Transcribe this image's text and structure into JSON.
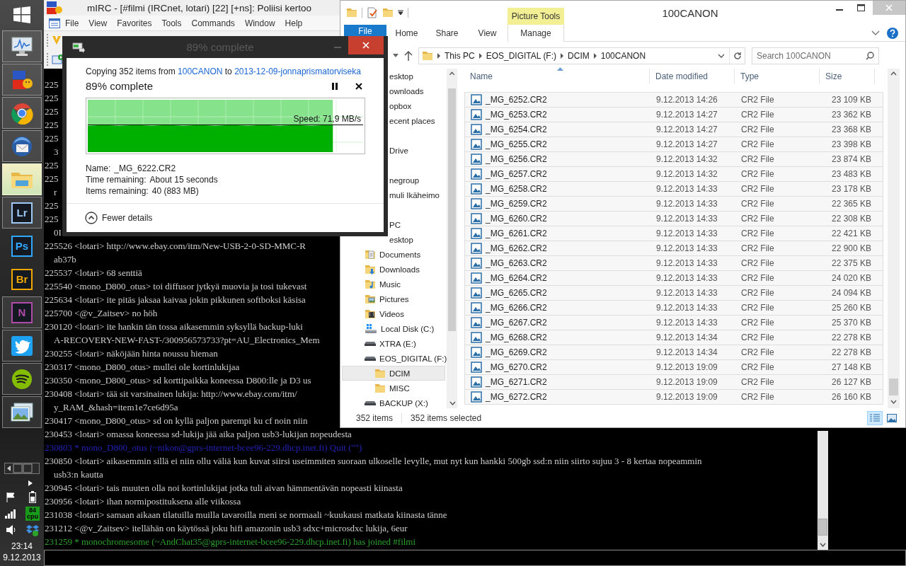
{
  "taskbar": {
    "apps": [
      {
        "kind": "monitor",
        "running": true,
        "active": false
      },
      {
        "kind": "mirc",
        "running": true,
        "active": false
      },
      {
        "kind": "chrome",
        "running": true,
        "active": false
      },
      {
        "kind": "thunderbird",
        "running": true,
        "active": false
      },
      {
        "kind": "explorer",
        "running": true,
        "active": true
      },
      {
        "kind": "letters",
        "label": "Lr",
        "color": "#9ec9f5",
        "running": true,
        "active": false
      },
      {
        "kind": "letters",
        "label": "Ps",
        "color": "#31a8ff",
        "running": false,
        "active": false
      },
      {
        "kind": "letters",
        "label": "Br",
        "color": "#f0a800",
        "running": false,
        "active": false
      },
      {
        "kind": "letters",
        "label": "N",
        "color": "#b04aa8",
        "running": true,
        "active": false
      },
      {
        "kind": "twitter",
        "running": true,
        "active": false
      },
      {
        "kind": "spotify",
        "running": true,
        "active": false
      },
      {
        "kind": "photos",
        "running": true,
        "active": false
      }
    ],
    "cpu": {
      "reading": "84",
      "label": "cpu"
    },
    "clock": {
      "time": "23:14",
      "date": "9.12.2013"
    }
  },
  "mirc": {
    "title": "mIRC - [#filmi (IRCnet, lotari) [22] [+ns]: Poliisi kertoo",
    "menu": [
      "File",
      "View",
      "Favorites",
      "Tools",
      "Commands",
      "Window",
      "Help"
    ],
    "chat": [
      {
        "kind": "message",
        "text": "225"
      },
      {
        "kind": "message",
        "text": "225"
      },
      {
        "kind": "message",
        "text": "225"
      },
      {
        "kind": "message",
        "text": "225"
      },
      {
        "kind": "message",
        "text": "225"
      },
      {
        "kind": "continuation",
        "text": "3"
      },
      {
        "kind": "message",
        "text": "225"
      },
      {
        "kind": "message",
        "text": "225"
      },
      {
        "kind": "continuation",
        "text": "r"
      },
      {
        "kind": "message",
        "text": "225"
      },
      {
        "kind": "message",
        "text": "225"
      },
      {
        "kind": "continuation",
        "text": "0I"
      },
      {
        "kind": "message",
        "text": "225526 <lotari> http://www.ebay.com/itm/New-USB-2-0-SD-MMC-R"
      },
      {
        "kind": "continuation",
        "text": "ab37b"
      },
      {
        "kind": "message",
        "text": "225537 <lotari> 68 senttiä"
      },
      {
        "kind": "message",
        "text": "225540 <mono_D800_otus> toi diffusor jytkyä muovia ja tosi tukevast"
      },
      {
        "kind": "message",
        "text": "225634 <lotari> ite pitäs jaksaa kaivaa jokin pikkunen softboksi käsisa"
      },
      {
        "kind": "message",
        "text": "225700 <@v_Zaitsev> no höh"
      },
      {
        "kind": "message",
        "text": "230120 <lotari> ite hankin tän tossa aikasemmin syksyllä backup-luki"
      },
      {
        "kind": "continuation",
        "text": "A-RECOVERY-NEW-FAST-/300956573733?pt=AU_Electronics_Mem"
      },
      {
        "kind": "message",
        "text": "230255 <lotari> näköjään hinta noussu hieman"
      },
      {
        "kind": "message",
        "text": "230317 <mono_D800_otus> mullei ole kortinlukijaa"
      },
      {
        "kind": "message",
        "text": "230350 <mono_D800_otus> sd korttipaikka koneessa D800:lle ja D3 us"
      },
      {
        "kind": "message",
        "text": "230408 <lotari> tää sit varsinainen lukija: http://www.ebay.com/itm/"
      },
      {
        "kind": "continuation",
        "text": "y_RAM_&hash=item1e7ce6d95a"
      },
      {
        "kind": "message",
        "text": "230417 <mono_D800_otus> sd on kyllä paljon parempi ku cf noin niin"
      },
      {
        "kind": "message",
        "text": "230453 <lotari> omassa koneessa sd-lukija jää aika paljon usb3-lukijan nopeudesta"
      },
      {
        "kind": "quit",
        "text": "230803 * mono_D800_otus (~nikon@gprs-internet-bcee96-229.dhcp.inet.fi) Quit (\"\")"
      },
      {
        "kind": "message",
        "text": "230850 <lotari> aikasemmin sillä ei niin ollu väliä kun kuvat siirsi useimmiten suoraan ulkoselle levylle, mut nyt kun hankki 500gb ssd:n niin siirto sujuu 3 - 8 kertaa nopeammin"
      },
      {
        "kind": "continuation",
        "text": "usb3:n kautta"
      },
      {
        "kind": "message",
        "text": "230945 <lotari> tais muuten olla noi kortinlukijat jotka tuli aivan hämmentävän nopeasti kiinasta"
      },
      {
        "kind": "message",
        "text": "230956 <lotari> ihan normipostituksena alle viikossa"
      },
      {
        "kind": "message",
        "text": "231038 <lotari> samaan aikaan tilatuilla muilla tavaroilla meni se normaali ~kuukausi matkata kiinasta tänne"
      },
      {
        "kind": "message",
        "text": "231212 <@v_Zaitsev> itellähän on käytössä joku hifi amazonin usb3 sdxc+microsdxc lukija, 6eur"
      },
      {
        "kind": "join",
        "text": "231259 * monochromesome (~AndChat35@gprs-internet-bcee96-229.dhcp.inet.fi) has joined #filmi"
      }
    ]
  },
  "explorer": {
    "title": "100CANON",
    "context_tab": "Picture Tools",
    "ribbon_tabs": [
      {
        "kind": "file",
        "label": "File"
      },
      {
        "kind": "tab",
        "label": "Home"
      },
      {
        "kind": "tab",
        "label": "Share"
      },
      {
        "kind": "tab",
        "label": "View"
      },
      {
        "kind": "context",
        "label": "Manage"
      }
    ],
    "breadcrumbs": [
      "This PC",
      "EOS_DIGITAL (F:)",
      "DCIM",
      "100CANON"
    ],
    "search": {
      "placeholder": "Search 100CANON"
    },
    "nav_groups": [
      {
        "items": [
          {
            "label": "esktop",
            "selected": false
          },
          {
            "label": "ownloads",
            "selected": false
          },
          {
            "label": "opbox",
            "selected": false
          },
          {
            "label": "ecent places",
            "selected": false
          }
        ]
      },
      {
        "items": [
          {
            "label": "Drive",
            "selected": false
          }
        ]
      },
      {
        "items": [
          {
            "label": "negroup",
            "selected": false,
            "children": [
              {
                "label": "muli Ikäheimo",
                "selected": false
              }
            ]
          }
        ]
      },
      {
        "items": [
          {
            "label": "PC",
            "selected": false,
            "children": [
              {
                "label": "esktop",
                "selected": false
              },
              {
                "label": "Documents",
                "kind": "documents",
                "selected": false
              },
              {
                "label": "Downloads",
                "kind": "downloads",
                "selected": false
              },
              {
                "label": "Music",
                "kind": "music",
                "selected": false
              },
              {
                "label": "Pictures",
                "kind": "pictures",
                "selected": false
              },
              {
                "label": "Videos",
                "kind": "videos",
                "selected": false
              },
              {
                "label": "Local Disk (C:)",
                "kind": "local-disk",
                "selected": false
              },
              {
                "label": "XTRA (E:)",
                "kind": "drive",
                "selected": false
              },
              {
                "label": "EOS_DIGITAL (F:)",
                "kind": "drive",
                "selected": false,
                "children": [
                  {
                    "label": "DCIM",
                    "kind": "folder",
                    "selected": true
                  },
                  {
                    "label": "MISC",
                    "kind": "folder",
                    "selected": false
                  }
                ]
              },
              {
                "label": "BACKUP (X:)",
                "kind": "drive",
                "selected": false
              }
            ]
          }
        ]
      }
    ],
    "columns": [
      "Name",
      "Date modified",
      "Type",
      "Size"
    ],
    "files": [
      {
        "name": "_MG_6252.CR2",
        "date": "9.12.2013 14:26",
        "type": "CR2 File",
        "size": "23 109 KB",
        "selected": true
      },
      {
        "name": "_MG_6253.CR2",
        "date": "9.12.2013 14:27",
        "type": "CR2 File",
        "size": "23 362 KB",
        "selected": true
      },
      {
        "name": "_MG_6254.CR2",
        "date": "9.12.2013 14:27",
        "type": "CR2 File",
        "size": "23 368 KB",
        "selected": true
      },
      {
        "name": "_MG_6255.CR2",
        "date": "9.12.2013 14:27",
        "type": "CR2 File",
        "size": "23 398 KB",
        "selected": true
      },
      {
        "name": "_MG_6256.CR2",
        "date": "9.12.2013 14:32",
        "type": "CR2 File",
        "size": "23 874 KB",
        "selected": true
      },
      {
        "name": "_MG_6257.CR2",
        "date": "9.12.2013 14:32",
        "type": "CR2 File",
        "size": "23 483 KB",
        "selected": true
      },
      {
        "name": "_MG_6258.CR2",
        "date": "9.12.2013 14:33",
        "type": "CR2 File",
        "size": "23 178 KB",
        "selected": true
      },
      {
        "name": "_MG_6259.CR2",
        "date": "9.12.2013 14:33",
        "type": "CR2 File",
        "size": "22 365 KB",
        "selected": true
      },
      {
        "name": "_MG_6260.CR2",
        "date": "9.12.2013 14:33",
        "type": "CR2 File",
        "size": "22 308 KB",
        "selected": true
      },
      {
        "name": "_MG_6261.CR2",
        "date": "9.12.2013 14:33",
        "type": "CR2 File",
        "size": "22 421 KB",
        "selected": true
      },
      {
        "name": "_MG_6262.CR2",
        "date": "9.12.2013 14:33",
        "type": "CR2 File",
        "size": "22 900 KB",
        "selected": true
      },
      {
        "name": "_MG_6263.CR2",
        "date": "9.12.2013 14:33",
        "type": "CR2 File",
        "size": "22 375 KB",
        "selected": true
      },
      {
        "name": "_MG_6264.CR2",
        "date": "9.12.2013 14:33",
        "type": "CR2 File",
        "size": "24 020 KB",
        "selected": true
      },
      {
        "name": "_MG_6265.CR2",
        "date": "9.12.2013 14:33",
        "type": "CR2 File",
        "size": "24 094 KB",
        "selected": true
      },
      {
        "name": "_MG_6266.CR2",
        "date": "9.12.2013 14:33",
        "type": "CR2 File",
        "size": "25 260 KB",
        "selected": true
      },
      {
        "name": "_MG_6267.CR2",
        "date": "9.12.2013 14:33",
        "type": "CR2 File",
        "size": "25 370 KB",
        "selected": true
      },
      {
        "name": "_MG_6268.CR2",
        "date": "9.12.2013 14:34",
        "type": "CR2 File",
        "size": "22 278 KB",
        "selected": true
      },
      {
        "name": "_MG_6269.CR2",
        "date": "9.12.2013 14:34",
        "type": "CR2 File",
        "size": "22 278 KB",
        "selected": true
      },
      {
        "name": "_MG_6270.CR2",
        "date": "9.12.2013 19:09",
        "type": "CR2 File",
        "size": "27 148 KB",
        "selected": true
      },
      {
        "name": "_MG_6271.CR2",
        "date": "9.12.2013 19:09",
        "type": "CR2 File",
        "size": "26 127 KB",
        "selected": true
      },
      {
        "name": "_MG_6272.CR2",
        "date": "9.12.2013 19:09",
        "type": "CR2 File",
        "size": "26 160 KB",
        "selected": true
      }
    ],
    "status": {
      "count": "352 items",
      "selection": "352 items selected"
    },
    "views": [
      {
        "kind": "details",
        "selected": true
      },
      {
        "kind": "tiles",
        "selected": false
      }
    ]
  },
  "copy_dialog": {
    "title": "89% complete",
    "copying": {
      "prefix": "Copying 352 items from",
      "source": "100CANON",
      "middle": "to",
      "destination": "2013-12-09-jonnaprismatorviseka"
    },
    "heading": "89% complete",
    "level": 0.89,
    "speed": "Speed: 71,9 MB/s",
    "details": [
      {
        "label": "Name:",
        "value": "_MG_6222.CR2"
      },
      {
        "label": "Time remaining:",
        "value": "About 15 seconds"
      },
      {
        "label": "Items remaining:",
        "value": "40 (883 MB)"
      }
    ],
    "toggle": "Fewer details"
  }
}
